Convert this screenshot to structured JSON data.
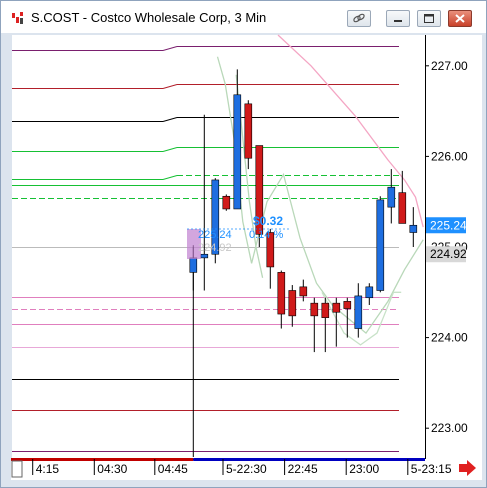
{
  "window": {
    "title": "S.COST - Costco Wholesale Corp, 3 Min",
    "icons": [
      "chart-app-icon",
      "link-icon",
      "minimize-icon",
      "restore-icon",
      "close-icon"
    ]
  },
  "chart_data": {
    "type": "candlestick",
    "symbol": "S.COST",
    "interval": "3 Min",
    "y_axis": {
      "side": "right",
      "ylim": [
        222.66,
        227.34
      ],
      "ticks": [
        227.0,
        226.0,
        225.0,
        224.0,
        223.0
      ],
      "tick_labels": [
        "227.00",
        "226.00",
        "225.00",
        "224.00",
        "223.00"
      ]
    },
    "x_axis": {
      "tick_labels": [
        "4:15",
        "04:30",
        "04:45",
        "5-22:30",
        "22:45",
        "23:00",
        "5-23:15"
      ],
      "tick_slots": [
        1.7,
        7.3,
        12.8,
        19.0,
        24.6,
        30.2,
        35.8
      ]
    },
    "price_label": {
      "value": "225.24",
      "color": "#1e90ff"
    },
    "prev_label": {
      "value": "224.92",
      "color": "#d8d8d8"
    },
    "annotation": {
      "change": "$0.32",
      "price": "225.24",
      "percent": "0.14 %",
      "faded_price": "224.92",
      "color": "#1e90ff"
    },
    "candles": [
      {
        "o": 224.72,
        "h": 225.02,
        "l": 224.52,
        "c": 224.88
      },
      {
        "o": 224.88,
        "h": 226.46,
        "l": 224.52,
        "c": 224.92
      },
      {
        "o": 224.92,
        "h": 225.76,
        "l": 224.82,
        "c": 225.74
      },
      {
        "o": 225.56,
        "h": 225.58,
        "l": 225.4,
        "c": 225.42
      },
      {
        "o": 225.42,
        "h": 226.96,
        "l": 225.42,
        "c": 226.68
      },
      {
        "o": 226.58,
        "h": 226.62,
        "l": 225.86,
        "c": 225.98
      },
      {
        "o": 226.12,
        "h": 226.1,
        "l": 225.0,
        "c": 225.14
      },
      {
        "o": 225.16,
        "h": 225.2,
        "l": 224.54,
        "c": 224.78
      },
      {
        "o": 224.72,
        "h": 224.74,
        "l": 224.1,
        "c": 224.26
      },
      {
        "o": 224.52,
        "h": 224.58,
        "l": 224.12,
        "c": 224.24
      },
      {
        "o": 224.56,
        "h": 224.64,
        "l": 224.4,
        "c": 224.46
      },
      {
        "o": 224.38,
        "h": 224.44,
        "l": 223.84,
        "c": 224.24
      },
      {
        "o": 224.38,
        "h": 224.44,
        "l": 223.84,
        "c": 224.22
      },
      {
        "o": 224.38,
        "h": 224.44,
        "l": 223.9,
        "c": 224.28
      },
      {
        "o": 224.4,
        "h": 224.44,
        "l": 224.0,
        "c": 224.32
      },
      {
        "o": 224.1,
        "h": 224.6,
        "l": 224.0,
        "c": 224.46
      },
      {
        "o": 224.44,
        "h": 224.6,
        "l": 224.36,
        "c": 224.56
      },
      {
        "o": 224.52,
        "h": 225.56,
        "l": 224.5,
        "c": 225.52
      },
      {
        "o": 225.44,
        "h": 225.86,
        "l": 225.26,
        "c": 225.66
      },
      {
        "o": 225.6,
        "h": 225.84,
        "l": 225.42,
        "c": 225.26
      },
      {
        "o": 225.16,
        "h": 225.44,
        "l": 225.0,
        "c": 225.24
      }
    ],
    "horizontal_levels": [
      {
        "y": 227.22,
        "color": "#7a1f6e",
        "style": "solid",
        "start": "previous"
      },
      {
        "y": 226.8,
        "color": "#b21f2a",
        "style": "solid",
        "start": "previous"
      },
      {
        "y": 226.44,
        "color": "#000000",
        "style": "solid",
        "start": "previous"
      },
      {
        "y": 226.1,
        "color": "#16c034",
        "style": "solid",
        "start": "previous"
      },
      {
        "y": 225.8,
        "color": "#16c034",
        "style": "dashed",
        "start": "previous"
      },
      {
        "y": 225.68,
        "color": "#16c034",
        "style": "solid",
        "start": "full"
      },
      {
        "y": 225.54,
        "color": "#16c034",
        "style": "dashed",
        "start": "full"
      },
      {
        "y": 225.0,
        "color": "#bbbbbb",
        "style": "solid",
        "start": "full"
      },
      {
        "y": 224.45,
        "color": "#e07fbe",
        "style": "solid",
        "start": "full"
      },
      {
        "y": 224.32,
        "color": "#e07fbe",
        "style": "dashed",
        "start": "full"
      },
      {
        "y": 224.15,
        "color": "#e07fbe",
        "style": "solid",
        "start": "full"
      },
      {
        "y": 223.9,
        "color": "#e8a8d8",
        "style": "solid",
        "start": "full"
      },
      {
        "y": 223.54,
        "color": "#000000",
        "style": "solid",
        "start": "full"
      },
      {
        "y": 223.2,
        "color": "#b21f2a",
        "style": "solid",
        "start": "full"
      },
      {
        "y": 222.75,
        "color": "#7a1f6e",
        "style": "solid",
        "start": "full"
      }
    ],
    "overlay_lines": [
      {
        "name": "",
        "color": "#f4a6c4",
        "points": [
          [
            24.0,
            227.34
          ],
          [
            27.0,
            227.0
          ],
          [
            31.0,
            226.45
          ],
          [
            34.0,
            225.96
          ],
          [
            35.5,
            225.74
          ],
          [
            36.5,
            225.55
          ],
          [
            37.2,
            225.22
          ]
        ]
      },
      {
        "name": "",
        "color": "#b9d8b9",
        "points": [
          [
            18.5,
            227.1
          ],
          [
            19.2,
            226.8
          ],
          [
            20.0,
            226.2
          ],
          [
            20.8,
            225.28
          ],
          [
            21.6,
            224.82
          ],
          [
            23.0,
            225.5
          ],
          [
            24.5,
            225.8
          ],
          [
            26.0,
            225.1
          ],
          [
            27.5,
            224.6
          ],
          [
            29.0,
            224.35
          ],
          [
            30.5,
            224.2
          ],
          [
            32.0,
            224.05
          ],
          [
            34.0,
            224.4
          ],
          [
            35.5,
            224.75
          ],
          [
            37.2,
            225.08
          ]
        ]
      },
      {
        "name": "",
        "color": "#b9d8b9",
        "points": [
          [
            20.2,
            226.9
          ],
          [
            20.8,
            226.2
          ],
          [
            21.4,
            225.5
          ],
          [
            22.0,
            225.0
          ],
          [
            22.6,
            224.66
          ]
        ]
      },
      {
        "name": "",
        "color": "#c8e2c8",
        "points": [
          [
            28.0,
            224.5
          ],
          [
            30.0,
            224.05
          ],
          [
            31.5,
            223.92
          ],
          [
            33.0,
            224.05
          ],
          [
            34.5,
            224.5
          ],
          [
            35.2,
            224.5
          ]
        ]
      }
    ],
    "session_start_slot": 16.3
  }
}
